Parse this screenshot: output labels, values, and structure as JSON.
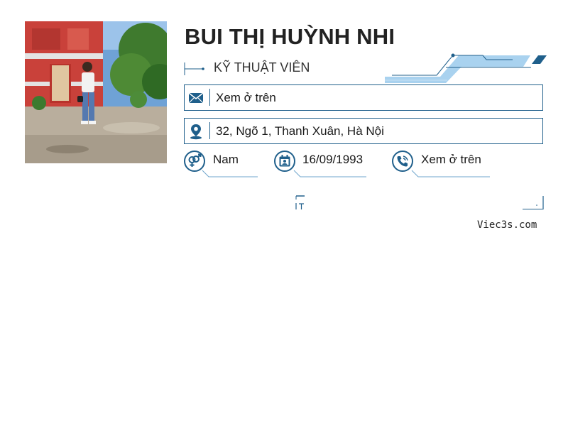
{
  "profile": {
    "name": "BUI THỊ HUỲNH NHI",
    "role": "KỸ THUẬT VIÊN",
    "photo_icon": "profile-photo"
  },
  "contact": {
    "email": {
      "icon": "envelope-icon",
      "value": "Xem ở trên"
    },
    "address": {
      "icon": "map-pin-icon",
      "value": "32, Ngõ 1, Thanh Xuân, Hà Nội"
    },
    "gender": {
      "icon": "gender-icon",
      "value": "Nam"
    },
    "birthday": {
      "icon": "calendar-icon",
      "value": "16/09/1993"
    },
    "phone": {
      "icon": "phone-icon",
      "value": "Xem ở trên"
    }
  },
  "footer": {
    "site": "Viec3s.com"
  },
  "colors": {
    "accent": "#1f5f8b",
    "light_accent": "#a9d2ef",
    "text": "#1a1a1a"
  }
}
